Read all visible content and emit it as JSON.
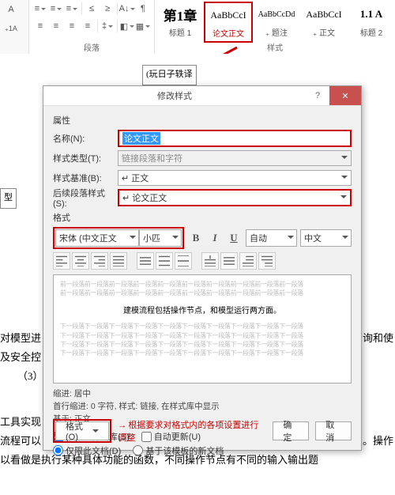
{
  "ribbon": {
    "group_para": "段落",
    "group_styles": "样式",
    "styles": [
      {
        "preview": "第1章",
        "label": "标题 1",
        "psize": "17px",
        "pweight": "bold"
      },
      {
        "preview": "AaBbCcI",
        "label": "论文正文",
        "psize": "12px",
        "pweight": "normal",
        "selected": true
      },
      {
        "preview": "AaBbCcDd",
        "label": "₊ 题注",
        "psize": "10px",
        "pweight": "normal"
      },
      {
        "preview": "AaBbCcI",
        "label": "₊ 正文",
        "psize": "12px",
        "pweight": "normal"
      },
      {
        "preview": "1.1 A",
        "label": "标题 2",
        "psize": "13px",
        "pweight": "bold"
      }
    ]
  },
  "dialog": {
    "title": "修改样式",
    "sections": {
      "props": "属性",
      "format": "格式"
    },
    "labels": {
      "name": "名称(N):",
      "styletype": "样式类型(T):",
      "basedon": "样式基准(B):",
      "follow": "后续段落样式(S):"
    },
    "values": {
      "name": "论文正文",
      "styletype": "链接段落和字符",
      "basedon": "↵ 正文",
      "follow": "↵ 论文正文",
      "font": "宋体 (中文正文",
      "size": "小匹",
      "auto": "自动",
      "lang": "中文"
    },
    "preview_sample": "建模流程包括操作节点，和模型运行两方面。",
    "preview_grey": "前一段落前一段落前一段落前一段落前一段落前一段落前一段落前一段落前一段落前一段落",
    "preview_grey2": "下一段落下一段落下一段落下一段落下一段落下一段落下一段落下一段落下一段落下一段落",
    "desc_l1": "缩进: 居中",
    "desc_l2": "首行缩进:  0 字符, 样式: 链接, 在样式库中显示",
    "desc_l3": "基于: 正文",
    "chk_add": "添加到样式库(S)",
    "chk_auto": "自动更新(U)",
    "radio_doc": "仅限此文档(D)",
    "radio_tpl": "基于该模板的新文档",
    "btn_format": "格式(O)",
    "btn_ok": "确定",
    "btn_cancel": "取消",
    "annotation": "根据要求对格式内的各项设置进行调整"
  },
  "doc": {
    "frag1": "(玩日子轶译",
    "box_left": "型",
    "line1": "对模型进",
    "line1b": "询和使",
    "line2": "及安全控",
    "line3": "（3）建札",
    "line4": "工具实现",
    "line5": "流程可以",
    "line5b": "。操作",
    "line6": "以看做是执行某种具体功能的函数，不同操作节点有不同的输入输出题"
  }
}
